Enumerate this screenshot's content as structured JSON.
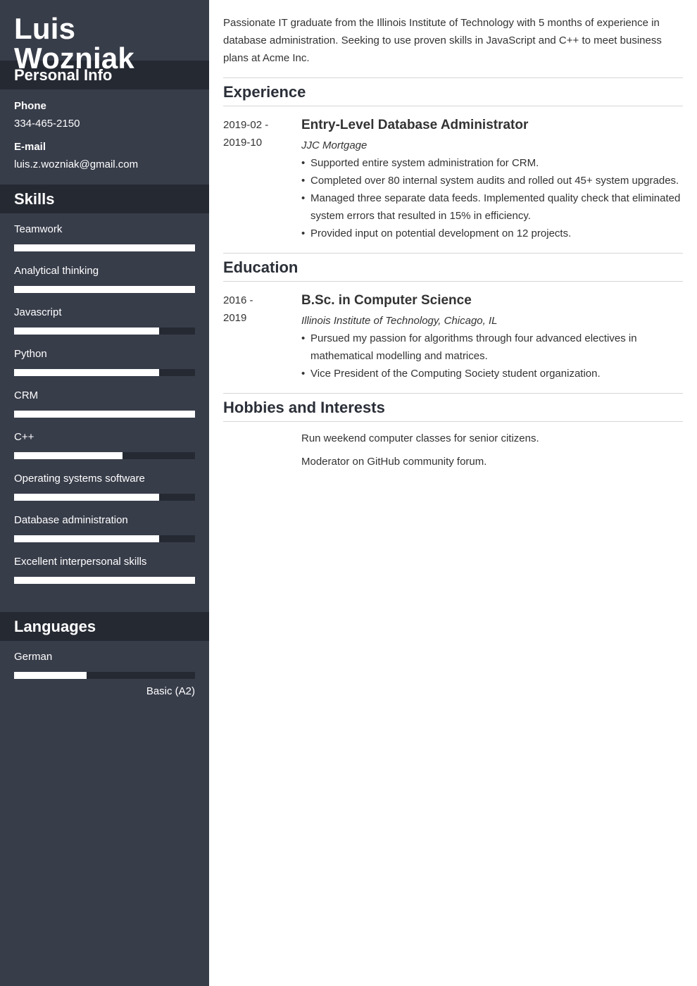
{
  "name": "Luis Wozniak",
  "sidebar": {
    "personal_info": {
      "title": "Personal Info",
      "phone_label": "Phone",
      "phone": "334-465-2150",
      "email_label": "E-mail",
      "email": "luis.z.wozniak@gmail.com"
    },
    "skills": {
      "title": "Skills",
      "items": [
        {
          "name": "Teamwork",
          "level": 1.0
        },
        {
          "name": "Analytical thinking",
          "level": 1.0
        },
        {
          "name": "Javascript",
          "level": 0.8
        },
        {
          "name": "Python",
          "level": 0.8
        },
        {
          "name": "CRM",
          "level": 1.0
        },
        {
          "name": "C++",
          "level": 0.6
        },
        {
          "name": "Operating systems software",
          "level": 0.8
        },
        {
          "name": "Database administration",
          "level": 0.8
        },
        {
          "name": "Excellent interpersonal skills",
          "level": 1.0
        }
      ]
    },
    "languages": {
      "title": "Languages",
      "items": [
        {
          "name": "German",
          "level": 0.4,
          "level_label": "Basic (A2)"
        }
      ]
    }
  },
  "main": {
    "summary": "Passionate IT graduate from the Illinois Institute of Technology with 5 months of experience in database administration. Seeking to use proven skills in JavaScript and C++ to meet business plans at Acme Inc.",
    "experience": {
      "title": "Experience",
      "entries": [
        {
          "date_start": "2019-02 -",
          "date_end": "2019-10",
          "title": "Entry-Level Database Administrator",
          "subtitle": "JJC Mortgage",
          "bullets": [
            "Supported entire system administration for CRM.",
            "Completed over 80 internal system audits and rolled out 45+ system upgrades.",
            "Managed three separate data feeds. Implemented quality check that eliminated system errors that resulted in 15% in efficiency.",
            "Provided input on potential development on 12 projects."
          ]
        }
      ]
    },
    "education": {
      "title": "Education",
      "entries": [
        {
          "date_start": "2016 -",
          "date_end": "2019",
          "title": "B.Sc. in Computer Science",
          "subtitle": "Illinois Institute of Technology, Chicago, IL",
          "bullets": [
            "Pursued my passion for algorithms through four advanced electives in mathematical modelling and matrices.",
            "Vice President of the Computing Society student organization."
          ]
        }
      ]
    },
    "hobbies": {
      "title": "Hobbies and Interests",
      "items": [
        "Run weekend computer classes for senior citizens.",
        "Moderator on GitHub community forum."
      ]
    }
  }
}
